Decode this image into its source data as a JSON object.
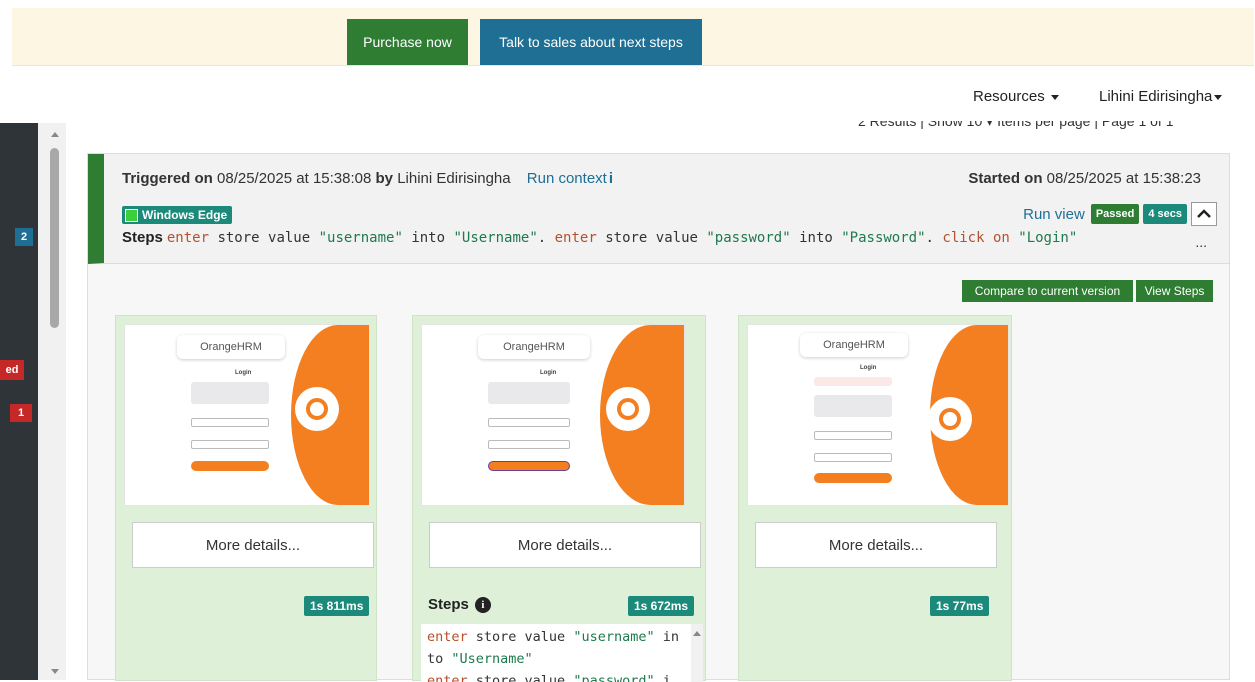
{
  "banner": {
    "purchase_label": "Purchase now",
    "sales_label": "Talk to sales about next steps"
  },
  "nav": {
    "resources_label": "Resources",
    "user_label": "Lihini Edirisingha"
  },
  "leftbar": {
    "badge_top": "2",
    "badge_mid": "ed",
    "badge_bottom": "1"
  },
  "results": {
    "text": "2 Results | Show  10  ▾  Items per page | Page 1 of 1"
  },
  "run": {
    "triggered_label": "Triggered on",
    "triggered_date": "08/25/2025",
    "at_label": "at",
    "triggered_time": "15:38:08",
    "by_label": "by",
    "triggered_by": "Lihini Edirisingha",
    "run_context_label": "Run context",
    "run_context_icon": "i",
    "started_label": "Started on",
    "started_date": "08/25/2025",
    "started_time": "15:38:23",
    "environment": "Windows Edge",
    "run_view_label": "Run view",
    "status": "Passed",
    "duration": "4 secs",
    "steps_label": "Steps",
    "steps": [
      {
        "t": "kw",
        "v": "enter"
      },
      {
        "t": "pl",
        "v": " store value "
      },
      {
        "t": "str",
        "v": "\"username\""
      },
      {
        "t": "pl",
        "v": " into "
      },
      {
        "t": "str",
        "v": "\"Username\""
      },
      {
        "t": "pl",
        "v": ". "
      },
      {
        "t": "kw",
        "v": "enter"
      },
      {
        "t": "pl",
        "v": " store value "
      },
      {
        "t": "str",
        "v": "\"password\""
      },
      {
        "t": "pl",
        "v": " into "
      },
      {
        "t": "str",
        "v": "\"Password\""
      },
      {
        "t": "pl",
        "v": ". "
      },
      {
        "t": "kw",
        "v": "click on"
      },
      {
        "t": "pl",
        "v": " "
      },
      {
        "t": "str",
        "v": "\"Login\""
      }
    ],
    "more_dots": "..."
  },
  "actions": {
    "compare_label": "Compare to current version",
    "view_steps_label": "View Steps"
  },
  "columns": [
    {
      "logo": "OrangeHRM",
      "title": "Login",
      "more_label": "More details...",
      "time": "1s 811ms"
    },
    {
      "logo": "OrangeHRM",
      "title": "Login",
      "more_label": "More details...",
      "time": "1s 672ms",
      "steps_label": "Steps",
      "steps_info": "i",
      "code_lines": [
        [
          {
            "t": "kw",
            "v": "enter"
          },
          {
            "t": "pl",
            "v": " store value "
          },
          {
            "t": "str",
            "v": "\"username\""
          },
          {
            "t": "pl",
            "v": " in"
          }
        ],
        [
          {
            "t": "pl",
            "v": "to "
          },
          {
            "t": "str",
            "v": "\"Username\""
          }
        ],
        [
          {
            "t": "kw",
            "v": "enter"
          },
          {
            "t": "pl",
            "v": " store value "
          },
          {
            "t": "str",
            "v": "\"password\""
          },
          {
            "t": "pl",
            "v": " i"
          }
        ]
      ]
    },
    {
      "logo": "OrangeHRM",
      "title": "Login",
      "more_label": "More details...",
      "time": "1s 77ms"
    }
  ],
  "colors": {
    "green": "#2e7d32",
    "teal": "#1b8a7a",
    "blue": "#1f6f94",
    "orange": "#f47f20",
    "danger": "#c62828"
  },
  "icons": {
    "caret": "caret-down-icon",
    "chevron_up": "chevron-up-icon",
    "info": "info-icon"
  }
}
